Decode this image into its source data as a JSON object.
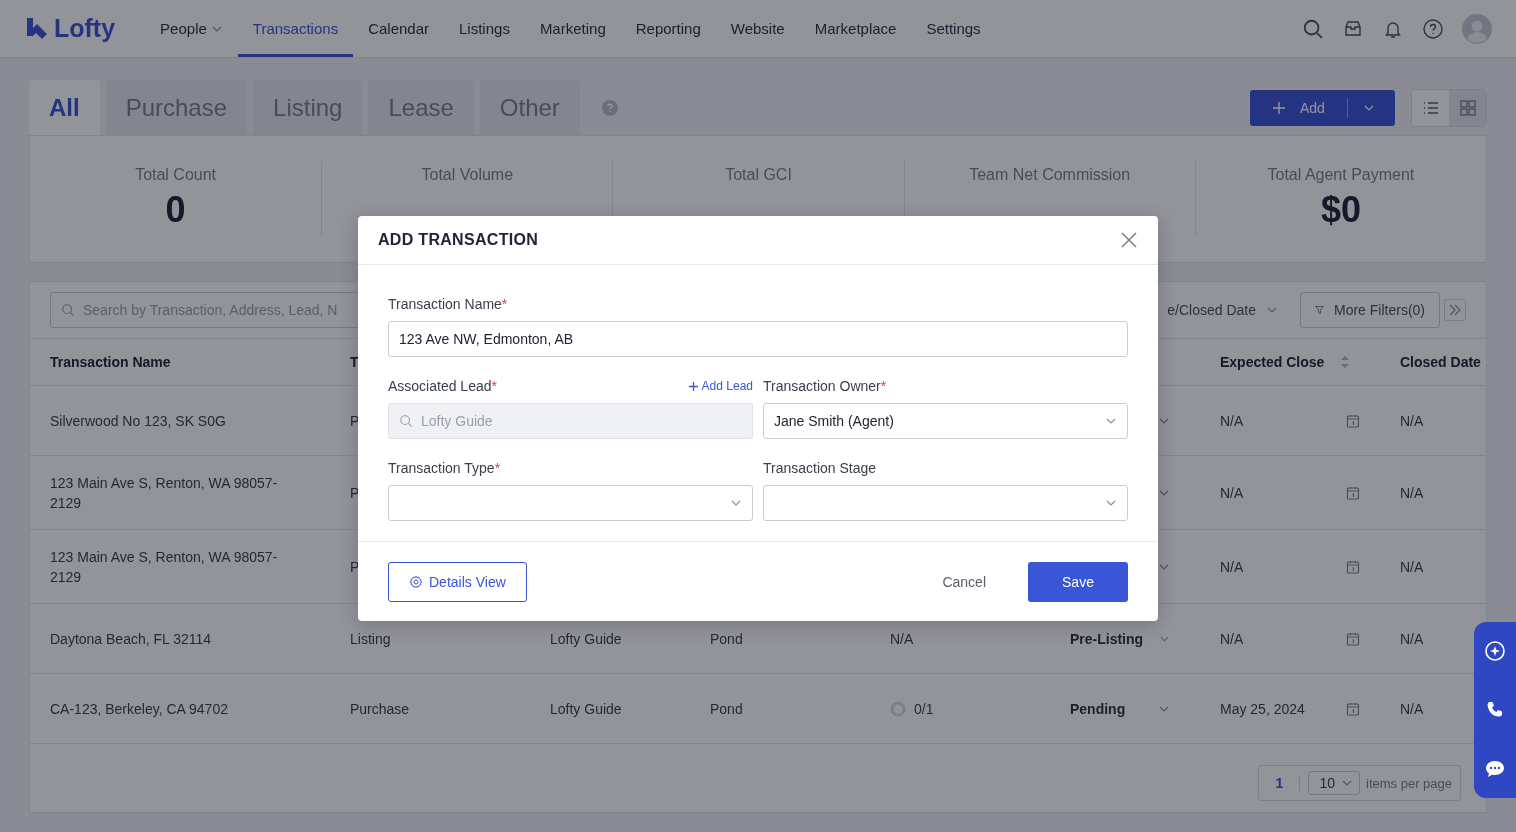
{
  "nav": {
    "logo": "Lofty",
    "items": [
      {
        "label": "People",
        "dropdown": true,
        "selected": false
      },
      {
        "label": "Transactions",
        "dropdown": false,
        "selected": true
      },
      {
        "label": "Calendar",
        "dropdown": false,
        "selected": false
      },
      {
        "label": "Listings",
        "dropdown": false,
        "selected": false
      },
      {
        "label": "Marketing",
        "dropdown": false,
        "selected": false
      },
      {
        "label": "Reporting",
        "dropdown": false,
        "selected": false
      },
      {
        "label": "Website",
        "dropdown": false,
        "selected": false
      },
      {
        "label": "Marketplace",
        "dropdown": false,
        "selected": false
      },
      {
        "label": "Settings",
        "dropdown": false,
        "selected": false
      }
    ]
  },
  "tabs": [
    {
      "label": "All",
      "selected": true
    },
    {
      "label": "Purchase",
      "selected": false
    },
    {
      "label": "Listing",
      "selected": false
    },
    {
      "label": "Lease",
      "selected": false
    },
    {
      "label": "Other",
      "selected": false
    }
  ],
  "add_button": "Add",
  "views": [
    {
      "kind": "list",
      "selected": true
    },
    {
      "kind": "grid",
      "selected": false
    }
  ],
  "stats": [
    {
      "label": "Total Count",
      "value": "0"
    },
    {
      "label": "Total Volume"
    },
    {
      "label": "Total GCI"
    },
    {
      "label": "Team Net Commission"
    },
    {
      "label": "Total Agent Payment",
      "value": "$0"
    }
  ],
  "filters": {
    "search_placeholder": "Search by Transaction, Address, Lead, N",
    "date_filter": "e/Closed Date",
    "more_filters": "More Filters(0)"
  },
  "table": {
    "header": {
      "name": "Transaction Name",
      "type": "T",
      "expected_close": "Expected Close",
      "closed_date": "Closed Date"
    },
    "rows": [
      {
        "name": "Silverwood No 123, SK S0G",
        "type": "P",
        "expected_close": "N/A",
        "closed_date": "N/A"
      },
      {
        "name": "123 Main Ave S, Renton, WA 98057-2129",
        "type": "P",
        "expected_close": "N/A",
        "closed_date": "N/A"
      },
      {
        "name": "123 Main Ave S, Renton, WA 98057-2129",
        "type": "P",
        "expected_close": "N/A",
        "closed_date": "N/A"
      },
      {
        "name": "Daytona Beach, FL 32114",
        "type": "Listing",
        "lead": "Lofty Guide",
        "pipeline": "Pond",
        "tasks": {
          "kind": "text",
          "text": "N/A"
        },
        "stage": "Pre-Listing",
        "expected_close": "N/A",
        "closed_date": "N/A"
      },
      {
        "name": "CA-123, Berkeley, CA 94702",
        "type": "Purchase",
        "lead": "Lofty Guide",
        "pipeline": "Pond",
        "tasks": {
          "kind": "progress",
          "text": "0/1"
        },
        "stage": "Pending",
        "expected_close": "May 25, 2024",
        "closed_date": "N/A"
      }
    ]
  },
  "pagination": {
    "page": "1",
    "page_size": "10",
    "page_size_label": "items per page"
  },
  "dialog": {
    "title": "ADD TRANSACTION",
    "fields": [
      {
        "kind": "text",
        "label": "Transaction Name",
        "mark": "*",
        "value": "123 Ave NW, Edmonton, AB",
        "disabled": false
      },
      {
        "kind": "search",
        "label": "Associated Lead",
        "mark": "*",
        "link": "Add Lead",
        "value": "Lofty Guide",
        "disabled": true
      },
      {
        "kind": "select",
        "label": "Transaction Owner",
        "mark": "*",
        "value": "Jane Smith (Agent)",
        "disabled": false
      },
      {
        "kind": "select",
        "label": "Transaction Type",
        "mark": "*",
        "disabled": false
      },
      {
        "kind": "select",
        "label": "Transaction Stage",
        "disabled": false
      }
    ],
    "details_button": "Details View",
    "cancel": "Cancel",
    "save": "Save"
  }
}
